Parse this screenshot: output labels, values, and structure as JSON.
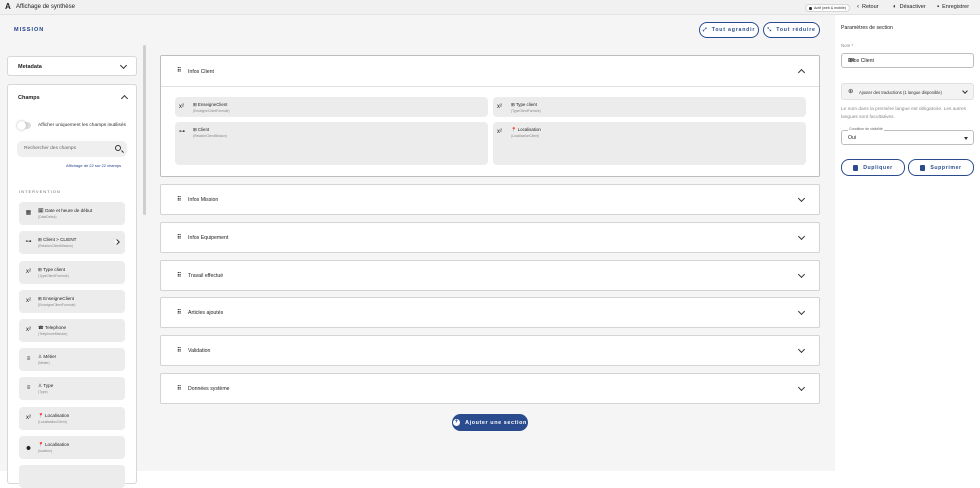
{
  "topbar": {
    "logo": "A",
    "title": "Affichage de synthèse",
    "badge": "Actif (web & mobile)",
    "back": "Retour",
    "deactivate": "Désactiver",
    "save": "Enregistrer"
  },
  "mission_label": "MISSION",
  "left": {
    "metadata_title": "Metadata",
    "fields_title": "Champs",
    "toggle_label": "Afficher uniquement les champs inutilisés",
    "search_placeholder": "Rechercher des champs",
    "count": "Affichage de 22 sur 22 champs",
    "section_label": "INTERVENTION",
    "fields": [
      {
        "icon": "calendar-icon",
        "glyph": "▦",
        "label": "🗓 Date et heure de début",
        "code": "(DateDebut)"
      },
      {
        "icon": "relation-icon",
        "glyph": "⊶",
        "label": "⊞ Client > CLIENT",
        "code": "(RelationClientMission)",
        "expandable": true
      },
      {
        "icon": "formula-icon",
        "glyph": "x²",
        "label": "⊞ Type client",
        "code": "(TypeClientFormule)"
      },
      {
        "icon": "formula-icon",
        "glyph": "x²",
        "label": "⊞ EnseigneClient",
        "code": "(EnseigneClientFormule)"
      },
      {
        "icon": "formula-icon",
        "glyph": "x²",
        "label": "☎ Telephone",
        "code": "(TelephoneMission)"
      },
      {
        "icon": "list-icon",
        "glyph": "≡",
        "label": "♙ Métier",
        "code": "(Metier)"
      },
      {
        "icon": "list-icon",
        "glyph": "≡",
        "label": "♙ Type",
        "code": "(Type)"
      },
      {
        "icon": "formula-icon",
        "glyph": "x²",
        "label": "📍 Localisation",
        "code": "(LocalisationClient)"
      },
      {
        "icon": "location-pin-icon",
        "glyph": "⬤",
        "label": "📍 Localisation",
        "code": "(location)"
      }
    ]
  },
  "center": {
    "expand_all": "Tout agrandir",
    "collapse_all": "Tout réduire",
    "expanded_section": {
      "title": "Infos Client",
      "cards": [
        {
          "icon": "formula-icon",
          "glyph": "x²",
          "label": "⊞ EnseigneClient",
          "code": "(EnseigneClientFormule)"
        },
        {
          "icon": "formula-icon",
          "glyph": "x²",
          "label": "⊞ Type client",
          "code": "(TypeClientFormule)"
        },
        {
          "icon": "relation-icon",
          "glyph": "⊶",
          "label": "⊞ Client",
          "code": "(RelationClientMission)"
        },
        {
          "icon": "formula-icon",
          "glyph": "x²",
          "label": "📍 Localisation",
          "code": "(LocalisationClient)"
        }
      ]
    },
    "sections": [
      "Infos Mission",
      "Infos Equipement",
      "Travail effectué",
      "Articles ajoutés",
      "Validation",
      "Données système"
    ],
    "add_section": "Ajouter une section"
  },
  "right": {
    "title": "Paramètres de section",
    "name_label": "Nom *",
    "name_value": "Infos Client",
    "lang": "FR",
    "translations": "Ajouter des traductions (1 langue disponible)",
    "hint": "Le nom dans la première langue est obligatoire. Les autres langues sont facultatives.",
    "condition_label": "Condition de visibilité",
    "condition_value": "Oui",
    "duplicate": "Dupliquer",
    "delete": "Supprimer"
  }
}
